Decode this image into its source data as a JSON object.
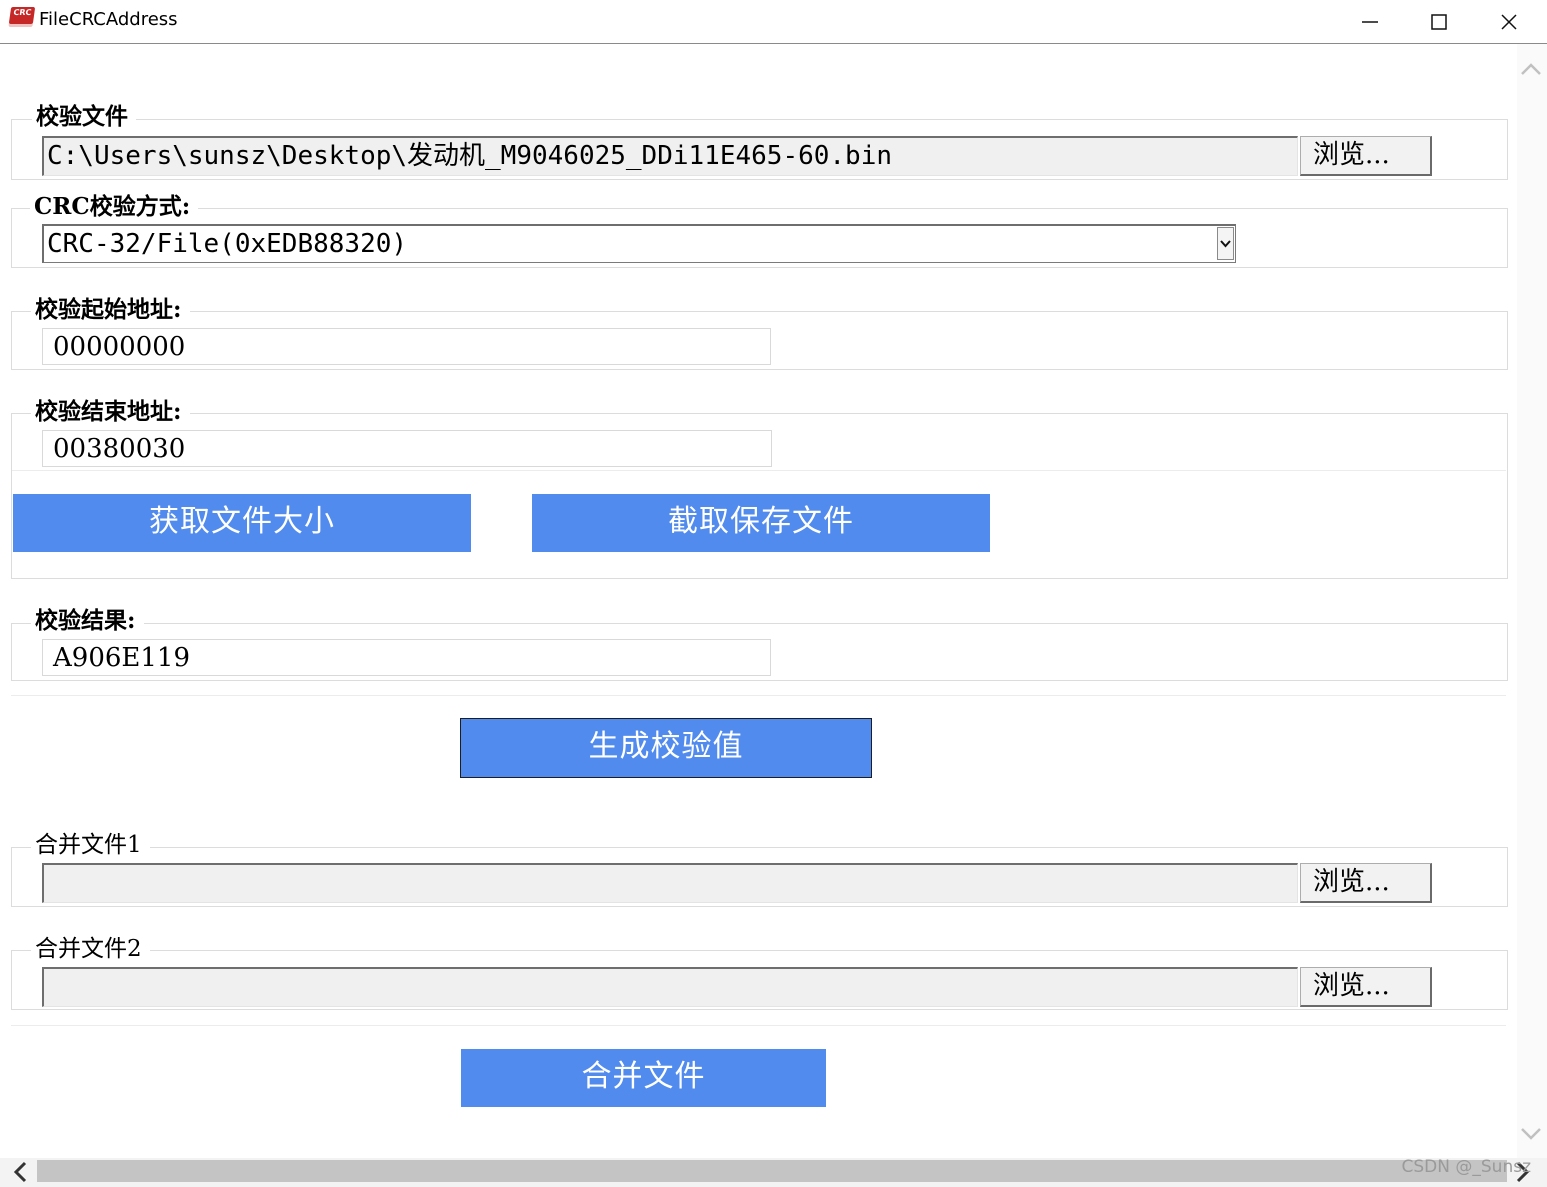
{
  "window": {
    "icon_text": "CRC",
    "title": "FileCRCAddress",
    "minimize_glyph": "—",
    "maximize_glyph": "☐",
    "close_glyph": "✕"
  },
  "file_group": {
    "label": "校验文件",
    "path": "C:\\Users\\sunsz\\Desktop\\发动机_M9046025_DDi11E465-60.bin",
    "browse_label": "浏览..."
  },
  "crc_group": {
    "label": "CRC校验方式:",
    "selected": "CRC-32/File(0xEDB88320)"
  },
  "start_group": {
    "label": "校验起始地址:",
    "value": "00000000"
  },
  "end_group": {
    "label": "校验结束地址:",
    "value": "00380030",
    "get_size_label": "获取文件大小",
    "cut_save_label": "截取保存文件"
  },
  "result_group": {
    "label": "校验结果:",
    "value": "A906E119"
  },
  "generate_label": "生成校验值",
  "merge1_group": {
    "label": "合并文件1",
    "path": "",
    "browse_label": "浏览..."
  },
  "merge2_group": {
    "label": "合并文件2",
    "path": "",
    "browse_label": "浏览..."
  },
  "merge_label": "合并文件",
  "watermark": "CSDN @_Sunsz"
}
